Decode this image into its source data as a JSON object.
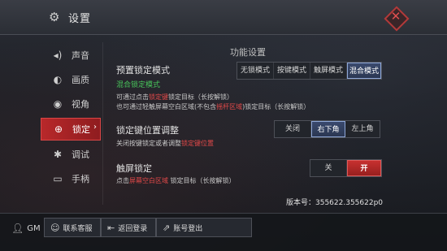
{
  "header": {
    "title": "设置"
  },
  "sidebar": {
    "items": [
      {
        "label": "声音",
        "icon": "speaker-icon",
        "active": false
      },
      {
        "label": "画质",
        "icon": "palette-icon",
        "active": false
      },
      {
        "label": "视角",
        "icon": "eye-icon",
        "active": false
      },
      {
        "label": "锁定",
        "icon": "crosshair-icon",
        "active": true
      },
      {
        "label": "调试",
        "icon": "bug-icon",
        "active": false
      },
      {
        "label": "手柄",
        "icon": "gamepad-icon",
        "active": false
      }
    ]
  },
  "main": {
    "section_title": "功能设置",
    "preset_mode": {
      "label": "预置锁定模式",
      "options": [
        "无锁模式",
        "按键模式",
        "触屏模式",
        "混合模式"
      ],
      "selected": "混合模式",
      "current": "混合锁定模式",
      "desc_line1_a": "可通过点击",
      "desc_line1_hl": "锁定键",
      "desc_line1_b": "锁定目标（长按解锁）",
      "desc_line2_a": "也可通过轻触屏幕空白区域(不包含",
      "desc_line2_hl": "摇杆区域",
      "desc_line2_b": ")锁定目标（长按解锁）"
    },
    "lock_key_position": {
      "label": "锁定键位置调整",
      "options": [
        "关闭",
        "右下角",
        "左上角"
      ],
      "selected": "右下角",
      "desc_a": "关闭按键锁定或者调整",
      "desc_hl": "锁定键位置"
    },
    "touch_lock": {
      "label": "触屏锁定",
      "options": [
        "关",
        "开"
      ],
      "selected": "开",
      "desc_a": "点击",
      "desc_hl": "屏幕空白区域",
      "desc_b": " 锁定目标（长按解锁）"
    },
    "version": "版本号：355622.355622p0"
  },
  "footer": {
    "gm_label": "GM",
    "contact_label": "联系客服",
    "back_login_label": "返回登录",
    "logout_label": "账号登出"
  },
  "colors": {
    "accent_red": "#b8282a",
    "selected_blue": "#8fa8d8",
    "green_text": "#47c25a",
    "highlight_red": "#e24949"
  }
}
